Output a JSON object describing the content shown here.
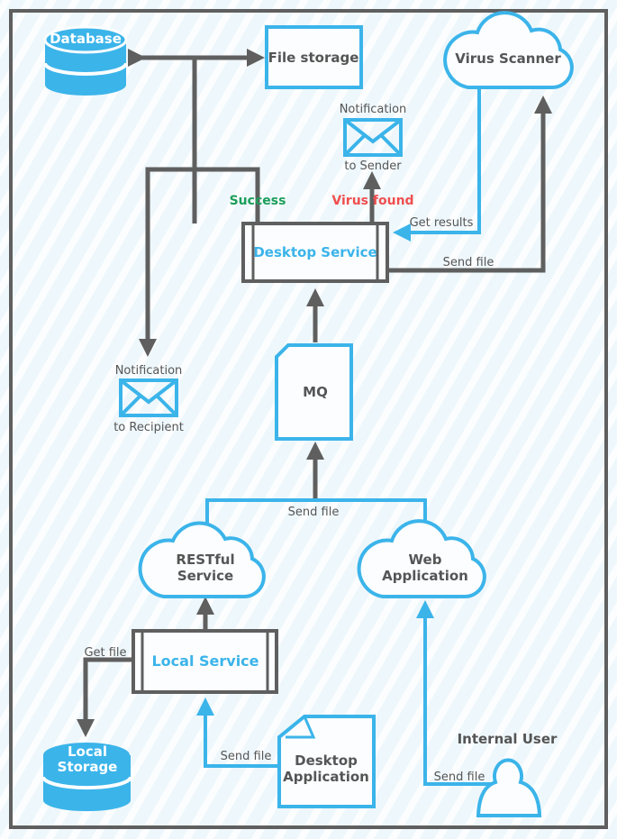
{
  "colors": {
    "accent": "#3bb4ea",
    "line": "#5f5f5f",
    "success": "#1a9e5a",
    "error": "#f04e4e"
  },
  "nodes": {
    "database": "Database",
    "file_storage": "File storage",
    "virus_scanner": "Virus Scanner",
    "notification_sender": {
      "top": "Notification",
      "bottom": "to Sender"
    },
    "desktop_service": "Desktop Service",
    "notification_recipient": {
      "top": "Notification",
      "bottom": "to Recipient"
    },
    "mq": "MQ",
    "restful_service": [
      "RESTful",
      "Service"
    ],
    "web_application": [
      "Web",
      "Application"
    ],
    "local_service": "Local Service",
    "local_storage": [
      "Local",
      "Storage"
    ],
    "desktop_application": [
      "Desktop",
      "Application"
    ],
    "internal_user": "Internal User"
  },
  "edges": {
    "success": "Success",
    "virus_found": "Virus found",
    "get_results": "Get results",
    "send_file_scanner": "Send file",
    "send_file_mq": "Send file",
    "get_file": "Get file",
    "send_file_desktop": "Send file",
    "send_file_user": "Send file"
  }
}
